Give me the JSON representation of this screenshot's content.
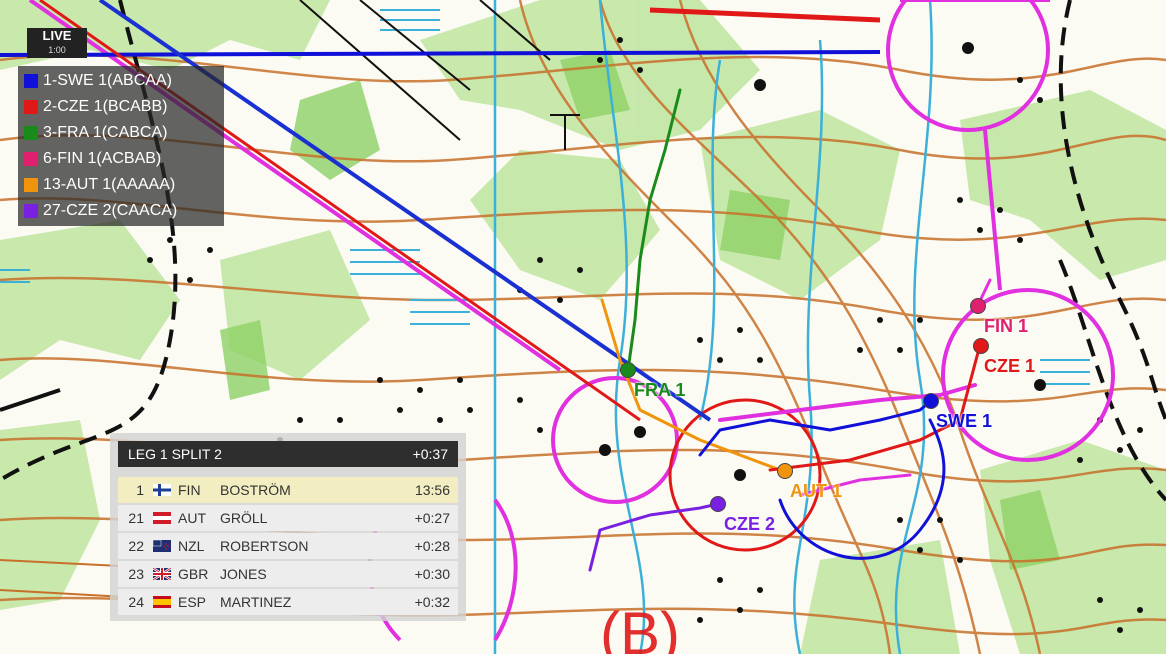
{
  "live": {
    "label": "LIVE",
    "clock": "1:00"
  },
  "legend": [
    {
      "label": "1-SWE 1(ABCAA)",
      "color": "#1010d8"
    },
    {
      "label": "2-CZE 1(BCABB)",
      "color": "#e01818"
    },
    {
      "label": "3-FRA 1(CABCA)",
      "color": "#1a8a1a"
    },
    {
      "label": "6-FIN 1(ACBAB)",
      "color": "#e0206e"
    },
    {
      "label": "13-AUT 1(AAAAA)",
      "color": "#f0940c"
    },
    {
      "label": "27-CZE 2(CAACA)",
      "color": "#7a20e0"
    }
  ],
  "splits": {
    "title": "LEG 1 SPLIT 2",
    "title_time": "+0:37",
    "rows": [
      {
        "rank": "1",
        "country": "FIN",
        "name": "BOSTRÖM",
        "time": "13:56",
        "flag": "fin-flag-icon"
      },
      {
        "rank": "21",
        "country": "AUT",
        "name": "GRÖLL",
        "time": "+0:27",
        "flag": "aut-flag-icon"
      },
      {
        "rank": "22",
        "country": "NZL",
        "name": "ROBERTSON",
        "time": "+0:28",
        "flag": "nzl-flag-icon"
      },
      {
        "rank": "23",
        "country": "GBR",
        "name": "JONES",
        "time": "+0:30",
        "flag": "gbr-flag-icon"
      },
      {
        "rank": "24",
        "country": "ESP",
        "name": "MARTINEZ",
        "time": "+0:32",
        "flag": "esp-flag-icon"
      }
    ]
  },
  "runners": [
    {
      "label": "FIN 1",
      "color": "#e0206e"
    },
    {
      "label": "CZE 1",
      "color": "#e01818"
    },
    {
      "label": "SWE 1",
      "color": "#1010d8"
    },
    {
      "label": "FRA 1",
      "color": "#1a8a1a"
    },
    {
      "label": "AUT 1",
      "color": "#f0940c"
    },
    {
      "label": "CZE 2",
      "color": "#7a20e0"
    }
  ]
}
